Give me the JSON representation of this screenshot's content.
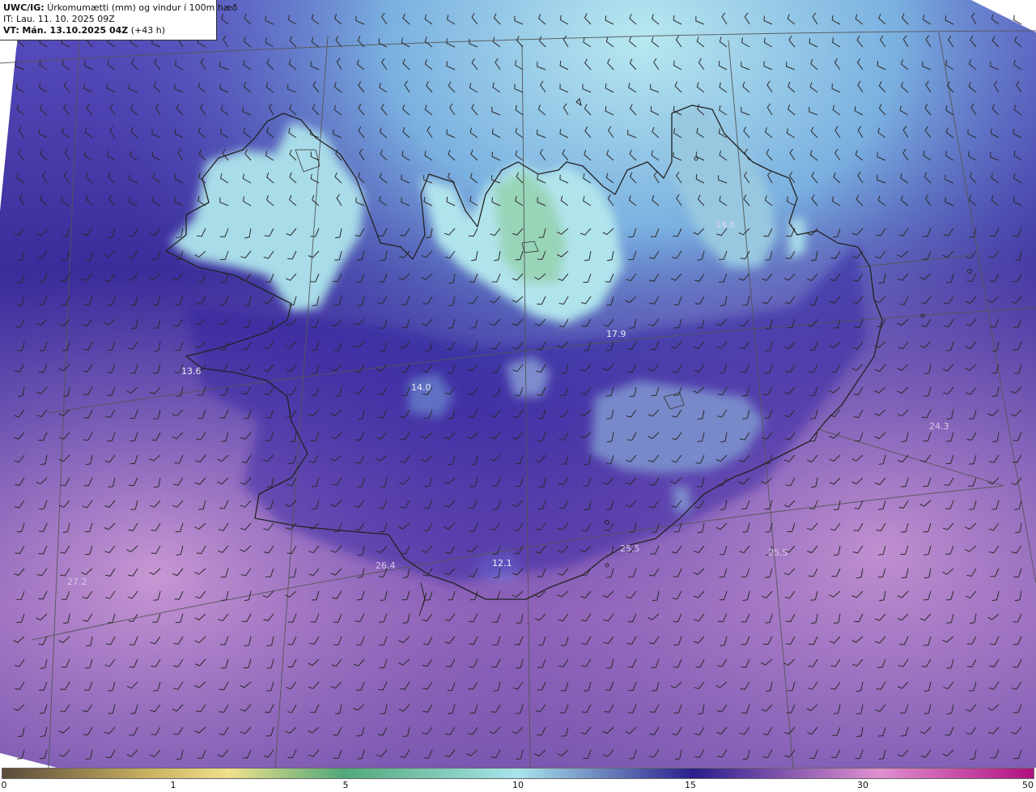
{
  "header": {
    "model_label": "UWC/IG:",
    "title": "Úrkomumætti (mm) og vindur í 100m hæð",
    "it_label": "IT:",
    "it_value": "Lau. 11. 10. 2025 09Z",
    "vt_label": "VT:",
    "vt_value": "Mán. 13.10.2025 04Z",
    "lead": "(+43 h)"
  },
  "map": {
    "value_labels": [
      {
        "text": "13.6",
        "color": "#e8e8f4"
      },
      {
        "text": "17.9",
        "color": "#e8e8f4"
      },
      {
        "text": "14.0",
        "color": "#e8e8f4"
      },
      {
        "text": "14.6",
        "color": "#d8d8ee"
      },
      {
        "text": "12.1",
        "color": "#f0f0f8"
      },
      {
        "text": "24.3",
        "color": "#d8c8e8"
      },
      {
        "text": "25.5",
        "color": "#d8c8e8"
      },
      {
        "text": "25.5",
        "color": "#d8c8e8"
      },
      {
        "text": "26.4",
        "color": "#d8c8e8"
      },
      {
        "text": "27.2",
        "color": "#d8c8e8"
      }
    ],
    "colors": {
      "land_outline": "#222222",
      "grid_lines": "#555555",
      "wind_barbs": "#2a2a2a",
      "low_values": "#3b2a9a",
      "mid_values": "#a8e4ec",
      "high_values": "#c890d0"
    }
  },
  "colorbar": {
    "ticks": [
      "0",
      "1",
      "5",
      "10",
      "15",
      "30",
      "50"
    ],
    "stops": [
      "#5a4a3a",
      "#c8b060",
      "#f0e08a",
      "#50a878",
      "#a8e4ec",
      "#2a1e8c",
      "#e090d0",
      "#b01080"
    ]
  }
}
